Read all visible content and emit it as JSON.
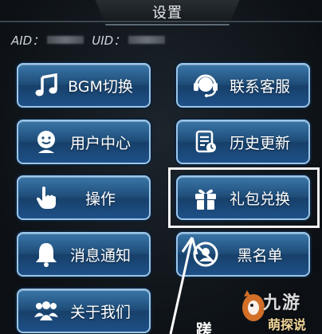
{
  "header": {
    "title": "设置"
  },
  "ids": {
    "aid_label": "AID：",
    "uid_label": "UID："
  },
  "buttons": [
    {
      "label": "BGM切换",
      "icon": "music-note-icon"
    },
    {
      "label": "联系客服",
      "icon": "headset-icon"
    },
    {
      "label": "用户中心",
      "icon": "user-face-icon"
    },
    {
      "label": "历史更新",
      "icon": "history-document-icon"
    },
    {
      "label": "操作",
      "icon": "hand-pointer-icon"
    },
    {
      "label": "礼包兑换",
      "icon": "gift-box-icon"
    },
    {
      "label": "消息通知",
      "icon": "bell-icon"
    },
    {
      "label": "黑名单",
      "icon": "blocked-user-icon"
    },
    {
      "label": "关于我们",
      "icon": "group-people-icon"
    }
  ],
  "bottom_partial_text": "蹉",
  "watermark": {
    "text": "九游",
    "subtext": "萌探说"
  },
  "colors": {
    "button_top": "#3a76a8",
    "button_bottom": "#1e5088",
    "button_border": "#9cc6e8",
    "highlight_box": "#f4f4f4"
  }
}
